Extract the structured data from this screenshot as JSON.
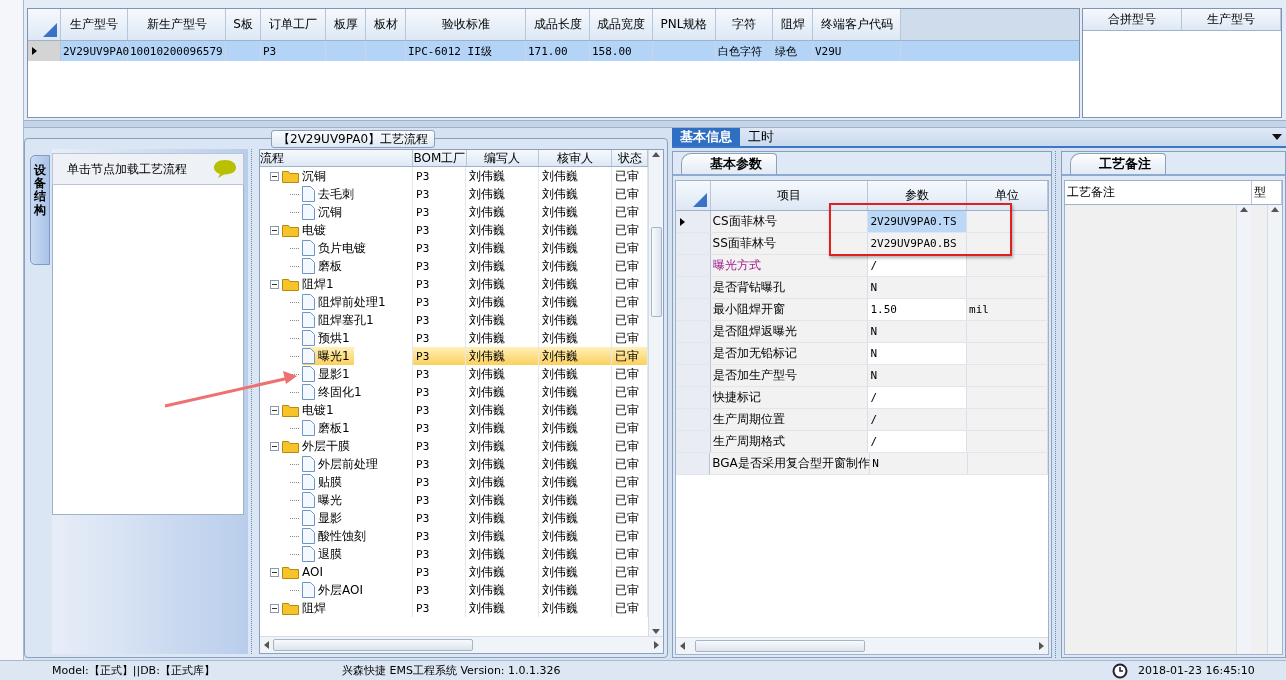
{
  "top_grid": {
    "row_selected": true,
    "columns": [
      {
        "header": "生产型号",
        "cell": "2V29UV9PA0"
      },
      {
        "header": "新生产型号",
        "cell": "10010200096579"
      },
      {
        "header": "S板"
      },
      {
        "header": "订单工厂",
        "cell": "P3"
      },
      {
        "header": "板厚"
      },
      {
        "header": "板材"
      },
      {
        "header": "验收标准",
        "cell": "IPC-6012 II级"
      },
      {
        "header": "成品长度",
        "cell": "171.00"
      },
      {
        "header": "成品宽度",
        "cell": "158.00"
      },
      {
        "header": "PNL规格"
      },
      {
        "header": "字符",
        "cell": "白色字符"
      },
      {
        "header": "阻焊",
        "cell": "绿色"
      },
      {
        "header": "终端客户代码",
        "cell": "V29U"
      }
    ]
  },
  "merge_grid": {
    "columns": [
      "合拼型号",
      "生产型号"
    ]
  },
  "flow_panel": {
    "title": "【2V29UV9PA0】工艺流程",
    "side_tab": "设备结构",
    "hint": "单击节点加载工艺流程",
    "columns": [
      "流程",
      "BOM工厂",
      "编写人",
      "核审人",
      "状态"
    ],
    "tree": [
      {
        "kind": "folder",
        "name": "沉铜",
        "expanded": true,
        "selected": false,
        "bom": "P3",
        "writer": "刘伟巍",
        "reviewer": "刘伟巍",
        "status": "已审",
        "children": [
          {
            "kind": "file",
            "name": "去毛刺",
            "selected": false,
            "bom": "P3",
            "writer": "刘伟巍",
            "reviewer": "刘伟巍",
            "status": "已审"
          },
          {
            "kind": "file",
            "name": "沉铜",
            "selected": false,
            "bom": "P3",
            "writer": "刘伟巍",
            "reviewer": "刘伟巍",
            "status": "已审"
          }
        ]
      },
      {
        "kind": "folder",
        "name": "电镀",
        "expanded": true,
        "selected": false,
        "bom": "P3",
        "writer": "刘伟巍",
        "reviewer": "刘伟巍",
        "status": "已审",
        "children": [
          {
            "kind": "file",
            "name": "负片电镀",
            "selected": false,
            "bom": "P3",
            "writer": "刘伟巍",
            "reviewer": "刘伟巍",
            "status": "已审"
          },
          {
            "kind": "file",
            "name": "磨板",
            "selected": false,
            "bom": "P3",
            "writer": "刘伟巍",
            "reviewer": "刘伟巍",
            "status": "已审"
          }
        ]
      },
      {
        "kind": "folder",
        "name": "阻焊1",
        "expanded": true,
        "selected": false,
        "bom": "P3",
        "writer": "刘伟巍",
        "reviewer": "刘伟巍",
        "status": "已审",
        "children": [
          {
            "kind": "file",
            "name": "阻焊前处理1",
            "selected": false,
            "bom": "P3",
            "writer": "刘伟巍",
            "reviewer": "刘伟巍",
            "status": "已审"
          },
          {
            "kind": "file",
            "name": "阻焊塞孔1",
            "selected": false,
            "bom": "P3",
            "writer": "刘伟巍",
            "reviewer": "刘伟巍",
            "status": "已审"
          },
          {
            "kind": "file",
            "name": "预烘1",
            "selected": false,
            "bom": "P3",
            "writer": "刘伟巍",
            "reviewer": "刘伟巍",
            "status": "已审"
          },
          {
            "kind": "file",
            "name": "曝光1",
            "selected": true,
            "bom": "P3",
            "writer": "刘伟巍",
            "reviewer": "刘伟巍",
            "status": "已审"
          },
          {
            "kind": "file",
            "name": "显影1",
            "selected": false,
            "bom": "P3",
            "writer": "刘伟巍",
            "reviewer": "刘伟巍",
            "status": "已审"
          },
          {
            "kind": "file",
            "name": "终固化1",
            "selected": false,
            "bom": "P3",
            "writer": "刘伟巍",
            "reviewer": "刘伟巍",
            "status": "已审"
          }
        ]
      },
      {
        "kind": "folder",
        "name": "电镀1",
        "expanded": true,
        "selected": false,
        "bom": "P3",
        "writer": "刘伟巍",
        "reviewer": "刘伟巍",
        "status": "已审",
        "children": [
          {
            "kind": "file",
            "name": "磨板1",
            "selected": false,
            "bom": "P3",
            "writer": "刘伟巍",
            "reviewer": "刘伟巍",
            "status": "已审"
          }
        ]
      },
      {
        "kind": "folder",
        "name": "外层干膜",
        "expanded": true,
        "selected": false,
        "bom": "P3",
        "writer": "刘伟巍",
        "reviewer": "刘伟巍",
        "status": "已审",
        "children": [
          {
            "kind": "file",
            "name": "外层前处理",
            "selected": false,
            "bom": "P3",
            "writer": "刘伟巍",
            "reviewer": "刘伟巍",
            "status": "已审"
          },
          {
            "kind": "file",
            "name": "贴膜",
            "selected": false,
            "bom": "P3",
            "writer": "刘伟巍",
            "reviewer": "刘伟巍",
            "status": "已审"
          },
          {
            "kind": "file",
            "name": "曝光",
            "selected": false,
            "bom": "P3",
            "writer": "刘伟巍",
            "reviewer": "刘伟巍",
            "status": "已审"
          },
          {
            "kind": "file",
            "name": "显影",
            "selected": false,
            "bom": "P3",
            "writer": "刘伟巍",
            "reviewer": "刘伟巍",
            "status": "已审"
          },
          {
            "kind": "file",
            "name": "酸性蚀刻",
            "selected": false,
            "bom": "P3",
            "writer": "刘伟巍",
            "reviewer": "刘伟巍",
            "status": "已审"
          },
          {
            "kind": "file",
            "name": "退膜",
            "selected": false,
            "bom": "P3",
            "writer": "刘伟巍",
            "reviewer": "刘伟巍",
            "status": "已审"
          }
        ]
      },
      {
        "kind": "folder",
        "name": "AOI",
        "expanded": true,
        "selected": false,
        "bom": "P3",
        "writer": "刘伟巍",
        "reviewer": "刘伟巍",
        "status": "已审",
        "children": [
          {
            "kind": "file",
            "name": "外层AOI",
            "selected": false,
            "bom": "P3",
            "writer": "刘伟巍",
            "reviewer": "刘伟巍",
            "status": "已审"
          }
        ]
      },
      {
        "kind": "folder",
        "name": "阻焊",
        "expanded": true,
        "selected": false,
        "bom": "P3",
        "writer": "刘伟巍",
        "reviewer": "刘伟巍",
        "status": "已审"
      }
    ]
  },
  "detail_tabs": [
    {
      "label": "基本信息",
      "selected": true
    },
    {
      "label": "工时",
      "selected": false
    }
  ],
  "param_panel": {
    "tab": "基本参数",
    "columns": [
      "项目",
      "参数",
      "单位"
    ],
    "rows": [
      {
        "item": "CS面菲林号",
        "value": "2V29UV9PA0.TS",
        "selected": true,
        "highlighted": false
      },
      {
        "item": "SS面菲林号",
        "value": "2V29UV9PA0.BS",
        "selected": false,
        "highlighted": false
      },
      {
        "item": "曝光方式",
        "value": "/",
        "selected": false,
        "highlighted": true
      },
      {
        "item": "是否背钻曝孔",
        "value": "N",
        "selected": false,
        "highlighted": false
      },
      {
        "item": "最小阻焊开窗",
        "value": "1.50",
        "unit": "mil",
        "selected": false,
        "highlighted": false
      },
      {
        "item": "是否阻焊返曝光",
        "value": "N",
        "selected": false,
        "highlighted": false
      },
      {
        "item": "是否加无铅标记",
        "value": "N",
        "selected": false,
        "highlighted": false
      },
      {
        "item": "是否加生产型号",
        "value": "N",
        "selected": false,
        "highlighted": false
      },
      {
        "item": "快捷标记",
        "value": "/",
        "selected": false,
        "highlighted": false
      },
      {
        "item": "生产周期位置",
        "value": "/",
        "selected": false,
        "highlighted": false
      },
      {
        "item": "生产周期格式",
        "value": "/",
        "selected": false,
        "highlighted": false
      },
      {
        "item": "BGA是否采用复合型开窗制作",
        "value": "N",
        "selected": false,
        "highlighted": false
      }
    ]
  },
  "remark_panel": {
    "tab": "工艺备注",
    "columns": [
      "工艺备注",
      "型"
    ]
  },
  "status_bar": {
    "environment": "Model:【正式】||DB:【正式库】",
    "app": "兴森快捷 EMS工程系统 Version: 1.0.1.326",
    "time": "2018-01-23 16:45:10"
  }
}
